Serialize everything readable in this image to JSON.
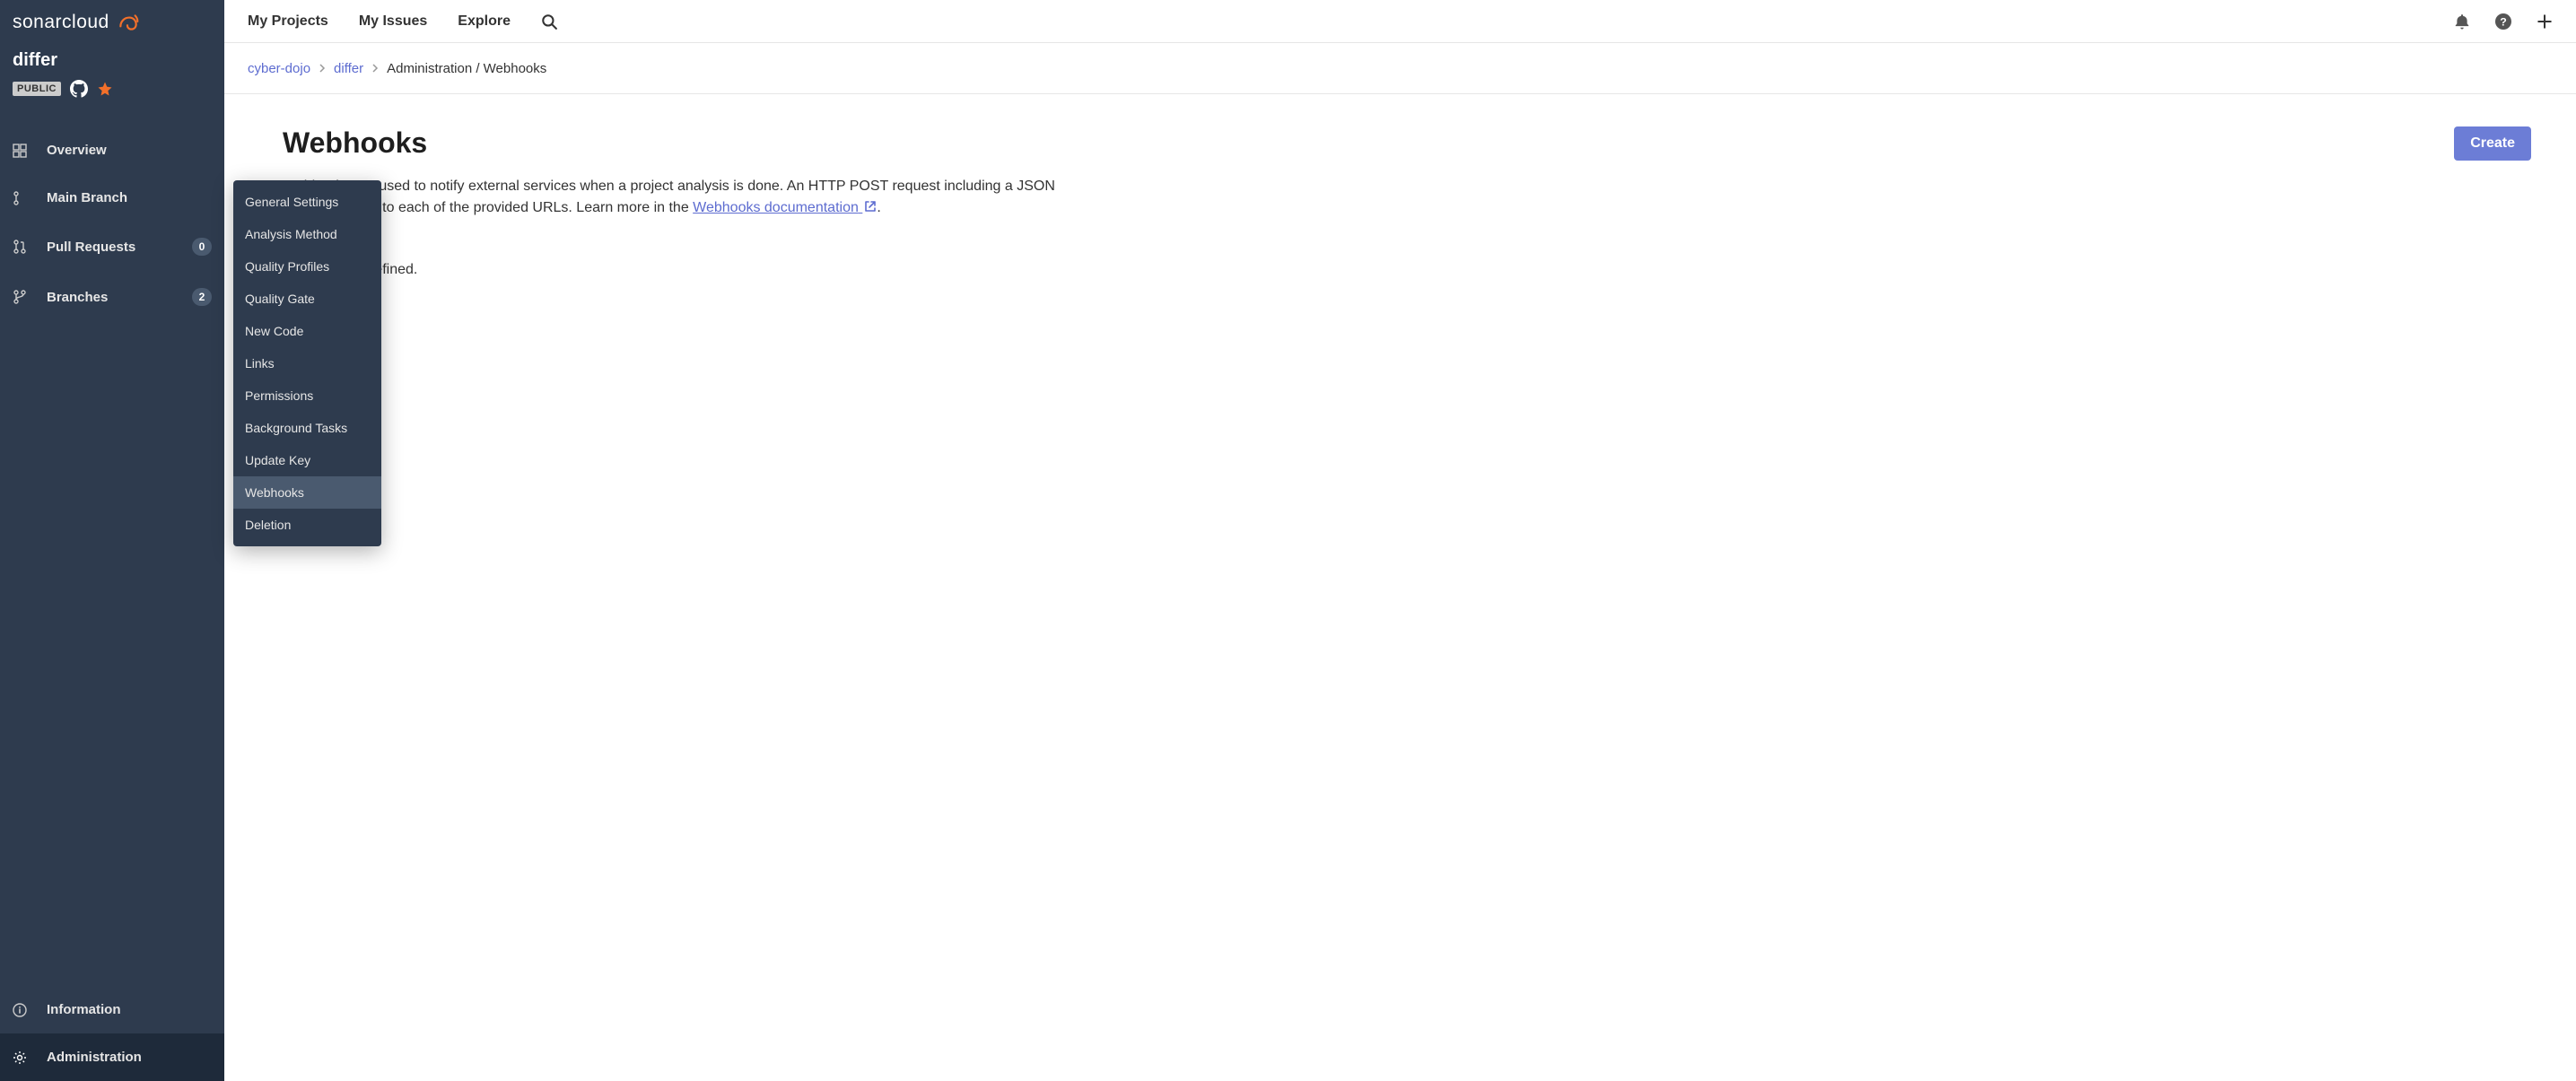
{
  "brand": {
    "name": "sonarcloud"
  },
  "project": {
    "name": "differ",
    "visibility": "PUBLIC"
  },
  "sidebar": {
    "items": [
      {
        "label": "Overview",
        "id": "overview"
      },
      {
        "label": "Main Branch",
        "id": "main-branch"
      },
      {
        "label": "Pull Requests",
        "id": "pull-requests",
        "count": "0"
      },
      {
        "label": "Branches",
        "id": "branches",
        "count": "2"
      }
    ],
    "bottom": [
      {
        "label": "Information",
        "id": "information"
      },
      {
        "label": "Administration",
        "id": "administration"
      }
    ]
  },
  "admin_menu": [
    {
      "label": "General Settings"
    },
    {
      "label": "Analysis Method"
    },
    {
      "label": "Quality Profiles"
    },
    {
      "label": "Quality Gate"
    },
    {
      "label": "New Code"
    },
    {
      "label": "Links"
    },
    {
      "label": "Permissions"
    },
    {
      "label": "Background Tasks"
    },
    {
      "label": "Update Key"
    },
    {
      "label": "Webhooks",
      "selected": true
    },
    {
      "label": "Deletion"
    }
  ],
  "topnav": [
    {
      "label": "My Projects"
    },
    {
      "label": "My Issues"
    },
    {
      "label": "Explore"
    }
  ],
  "breadcrumb": {
    "org": "cyber-dojo",
    "project": "differ",
    "current": "Administration / Webhooks"
  },
  "page": {
    "title": "Webhooks",
    "desc_1": "Webhooks are used to notify external services when a project analysis is done. An HTTP POST request including a JSON payload is sent to each of the provided URLs. Learn more in the ",
    "doc_link_label": "Webhooks documentation",
    "desc_2": ".",
    "empty_state": "No webhook defined.",
    "create_label": "Create"
  }
}
